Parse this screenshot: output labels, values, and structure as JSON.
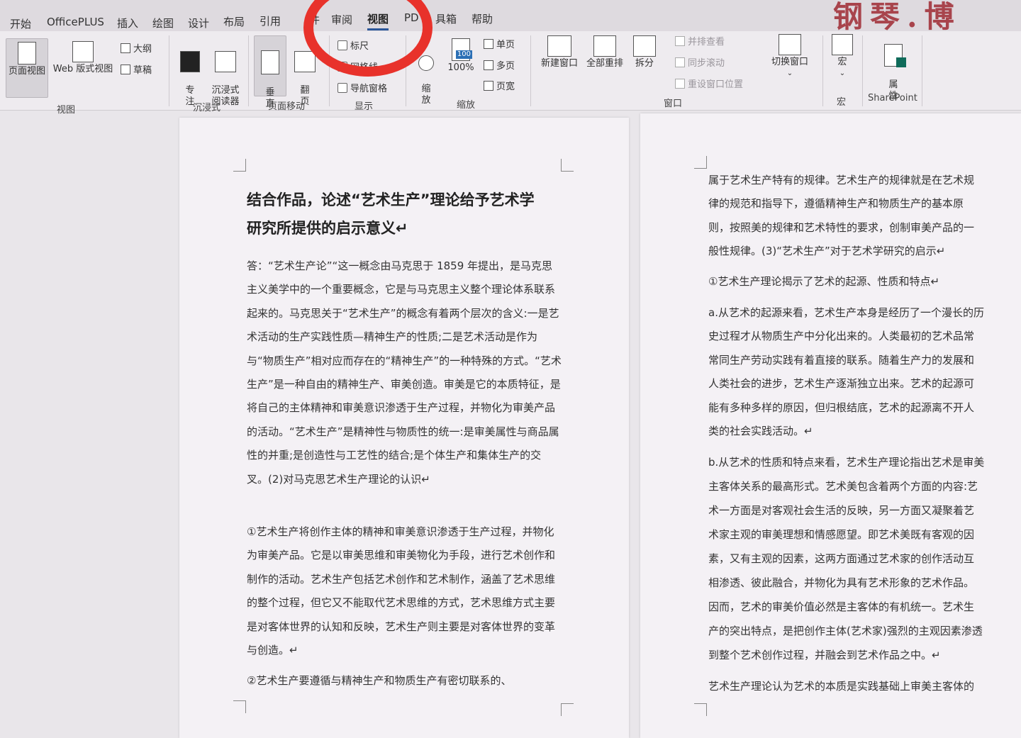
{
  "tabs": [
    "开始",
    "OfficePLUS",
    "插入",
    "绘图",
    "设计",
    "布局",
    "引用",
    "件",
    "审阅",
    "视图",
    "PD",
    "具箱",
    "帮助"
  ],
  "active_tab": "视图",
  "corner_title": "钢琴.博",
  "ribbon": {
    "views": {
      "label": "视图",
      "page_view": "页面视图",
      "web_view": "Web 版式视图",
      "outline": "大纲",
      "draft": "草稿"
    },
    "immersive": {
      "label": "沉浸式",
      "focus": "专\n注",
      "reader": "沉浸式\n阅读器"
    },
    "page_move": {
      "label": "页面移动",
      "vertical": "垂\n直",
      "flip": "翻\n页"
    },
    "show": {
      "label": "显示",
      "ruler": "标尺",
      "gridlines": "网格线",
      "nav_pane": "导航窗格"
    },
    "zoom": {
      "label": "缩放",
      "zoom": "缩\n放",
      "percent": "100%",
      "icon_text": "100",
      "one_page": "单页",
      "multi_page": "多页",
      "page_width": "页宽"
    },
    "window": {
      "label": "窗口",
      "new_window": "新建窗口",
      "arrange_all": "全部重排",
      "split": "拆分",
      "side_by_side": "并排查看",
      "sync_scroll": "同步滚动",
      "reset_position": "重设窗口位置",
      "switch_window": "切换窗口"
    },
    "macros": {
      "label": "宏",
      "macro": "宏"
    },
    "sharepoint": {
      "label": "SharePoint",
      "properties": "属\n性"
    }
  },
  "doc_left": {
    "title_line1": "结合作品，论述“艺术生产”理论给予艺术学",
    "title_line2": "研究所提供的启示意义↵",
    "paragraph1": "答：“艺术生产论”“这一概念由马克思于 1859 年提出，是马克思主义美学中的一个重要概念，它是与马克思主义整个理论体系联系起来的。马克思关于“艺术生产”的概念有着两个层次的含义:一是艺术活动的生产实践性质—精神生产的性质;二是艺术活动是作为与“物质生产”相对应而存在的“精神生产”的一种特殊的方式。“艺术生产”是一种自由的精神生产、审美创造。审美是它的本质特征，是将自己的主体精神和审美意识渗透于生产过程，并物化为审美产品的活动。“艺术生产”是精神性与物质性的统一:是审美属性与商品属性的并重;是创造性与工艺性的结合;是个体生产和集体生产的交叉。(2)对马克思艺术生产理论的认识↵",
    "paragraph2": "①艺术生产将创作主体的精神和审美意识渗透于生产过程，并物化为审美产品。它是以审美思维和审美物化为手段，进行艺术创作和制作的活动。艺术生产包括艺术创作和艺术制作，涵盖了艺术思维的整个过程，但它又不能取代艺术思维的方式，艺术思维方式主要是对客体世界的认知和反映，艺术生产则主要是对客体世界的变革与创造。↵",
    "paragraph3": "②艺术生产要遵循与精神生产和物质生产有密切联系的、"
  },
  "doc_right": {
    "lines": [
      "属于艺术生产特有的规律。艺术生产的规律就是在艺术规",
      "律的规范和指导下，遵循精神生产和物质生产的基本原",
      "则，按照美的规律和艺术特性的要求，创制审美产品的一",
      "般性规律。(3)“艺术生产”对于艺术学研究的启示↵",
      "①艺术生产理论揭示了艺术的起源、性质和特点↵",
      "a.从艺术的起源来看，艺术生产本身是经历了一个漫长的历",
      "史过程才从物质生产中分化出来的。人类最初的艺术品常",
      "常同生产劳动实践有着直接的联系。随着生产力的发展和",
      "人类社会的进步，艺术生产逐渐独立出来。艺术的起源可",
      "能有多种多样的原因，但归根结底，艺术的起源离不开人",
      "类的社会实践活动。↵",
      "b.从艺术的性质和特点来看，艺术生产理论指出艺术是审美",
      "主客体关系的最高形式。艺术美包含着两个方面的内容:艺",
      "术一方面是对客观社会生活的反映，另一方面又凝聚着艺",
      "术家主观的审美理想和情感愿望。即艺术美既有客观的因",
      "素，又有主观的因素，这两方面通过艺术家的创作活动互",
      "相渗透、彼此融合，并物化为具有艺术形象的艺术作品。",
      "因而，艺术的审美价值必然是主客体的有机统一。艺术生",
      "产的突出特点，是把创作主体(艺术家)强烈的主观因素渗透",
      "到整个艺术创作过程，并融会到艺术作品之中。↵",
      "艺术生产理论认为艺术的本质是实践基础上审美主客体的"
    ]
  },
  "colors": {
    "accent": "#2b579a",
    "annotation_red": "#e8322b"
  }
}
